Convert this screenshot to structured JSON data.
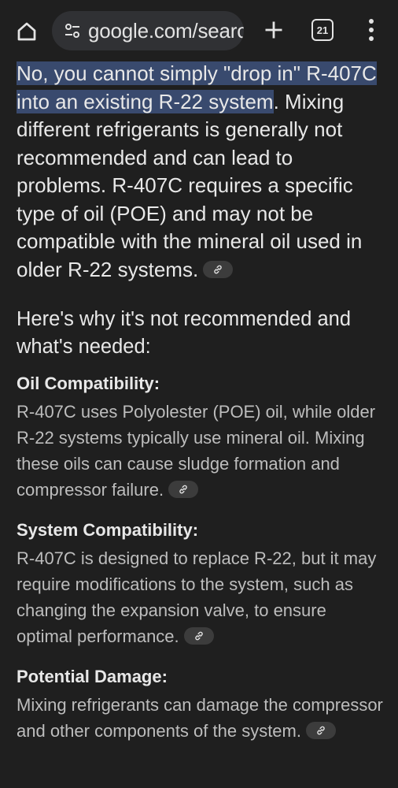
{
  "browser": {
    "url": "google.com/searc",
    "tab_count": "21"
  },
  "answer": {
    "highlight": "No, you cannot simply \"drop in\" R-407C into an existing R-22 system",
    "rest": ". Mixing different refrigerants is generally not recommended and can lead to problems. R-407C requires a specific type of oil (POE) and may not be compatible with the mineral oil used in older R-22 systems.",
    "subheading": "Here's why it's not recommended and what's needed:",
    "sections": [
      {
        "title": "Oil Compatibility:",
        "body": "R-407C uses Polyolester (POE) oil, while older R-22 systems typically use mineral oil. Mixing these oils can cause sludge formation and compressor failure."
      },
      {
        "title": "System Compatibility:",
        "body": "R-407C is designed to replace R-22, but it may require modifications to the system, such as changing the expansion valve, to ensure optimal performance."
      },
      {
        "title": "Potential Damage:",
        "body": "Mixing refrigerants can damage the compressor and other components of the system."
      }
    ]
  }
}
